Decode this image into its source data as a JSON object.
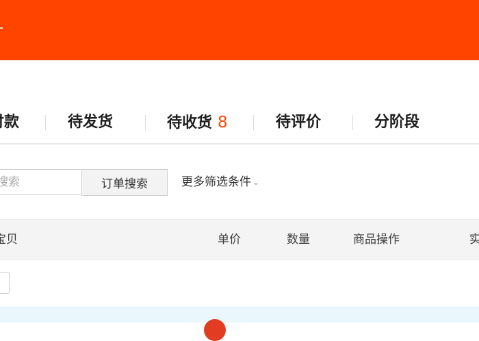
{
  "tabs": [
    {
      "label": "付款",
      "count": ""
    },
    {
      "label": "待发货",
      "count": ""
    },
    {
      "label": "待收货",
      "count": "8"
    },
    {
      "label": "待评价",
      "count": ""
    },
    {
      "label": "分阶段",
      "count": ""
    }
  ],
  "search": {
    "placeholder": "搜索",
    "button_label": "订单搜索",
    "more_filters_label": "更多筛选条件"
  },
  "table": {
    "columns": [
      "宝贝",
      "单价",
      "数量",
      "商品操作",
      "实"
    ]
  },
  "colors": {
    "accent": "#ff4400",
    "order_strip": "#eaf8fe",
    "badge": "#e23d22"
  }
}
